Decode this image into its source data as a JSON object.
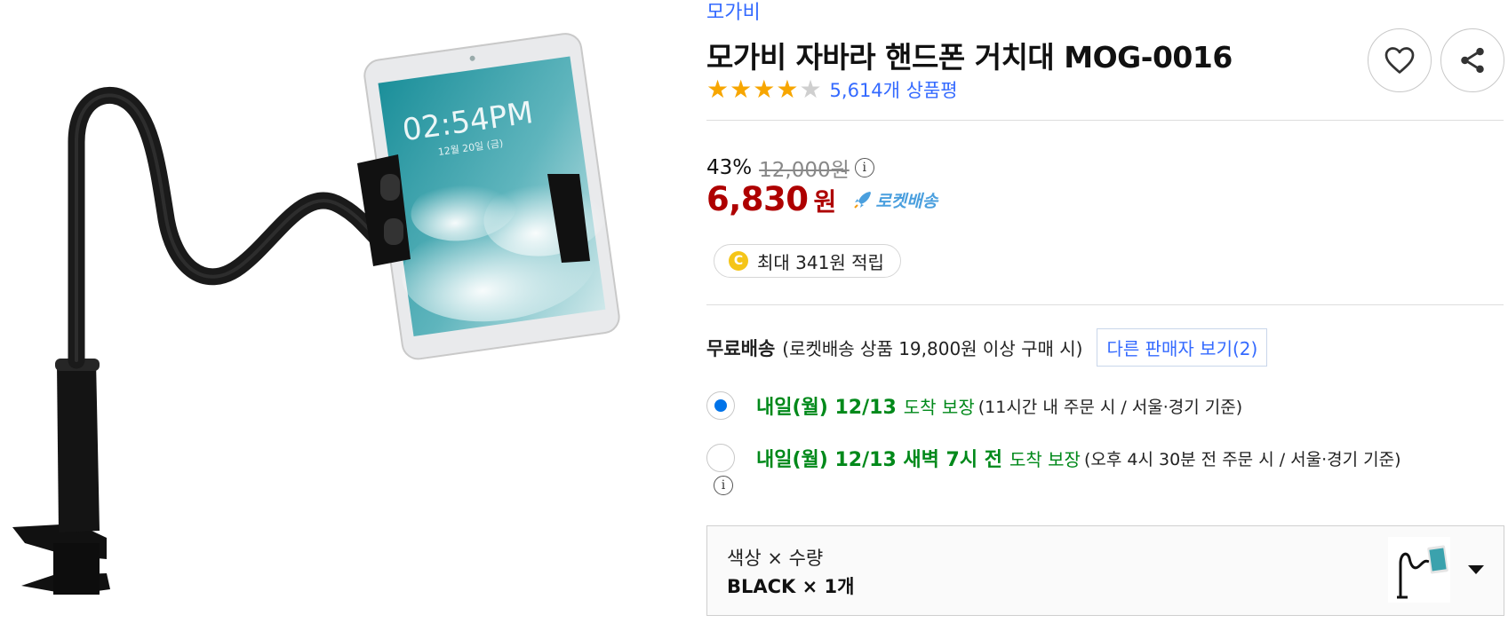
{
  "product": {
    "brand": "모가비",
    "title": "모가비 자바라 핸드폰 거치대 MOG-0016",
    "rating": {
      "stars": 4,
      "max_stars": 5,
      "review_count_text": "5,614개 상품평"
    },
    "image": {
      "tablet_clock": "02:54PM",
      "tablet_date": "12월 20일 (금)"
    }
  },
  "price": {
    "discount": "43%",
    "original": "12,000원",
    "sale": "6,830",
    "sale_unit": "원",
    "rocket_label": "로켓배송",
    "reward_coin": "C",
    "reward_text": "최대 341원 적립"
  },
  "shipping": {
    "label": "무료배송",
    "condition": "(로켓배송 상품 19,800원 이상 구매 시)",
    "other_sellers": "다른 판매자 보기(2)"
  },
  "delivery_options": [
    {
      "selected": true,
      "date": "내일(월) 12/13",
      "guarantee": "도착 보장",
      "condition": "(11시간 내 주문 시 / 서울·경기 기준)"
    },
    {
      "selected": false,
      "date": "내일(월) 12/13 새벽 7시 전",
      "guarantee": "도착 보장",
      "condition": "(오후 4시 30분 전 주문 시 / 서울·경기 기준)"
    }
  ],
  "option_selector": {
    "labels": "색상 × 수량",
    "value": "BLACK × 1개"
  },
  "colors": {
    "accent_blue": "#346aff",
    "sale_red": "#ae0000",
    "delivery_green": "#00891a",
    "star_orange": "#f7a600",
    "rocket_blue": "#4a9fde",
    "radio_blue": "#0073e9"
  },
  "icons": {
    "wishlist": "heart-icon",
    "share": "share-icon",
    "info": "info-icon",
    "rocket": "rocket-icon",
    "coin": "coin-icon",
    "dropdown": "chevron-down-icon"
  }
}
